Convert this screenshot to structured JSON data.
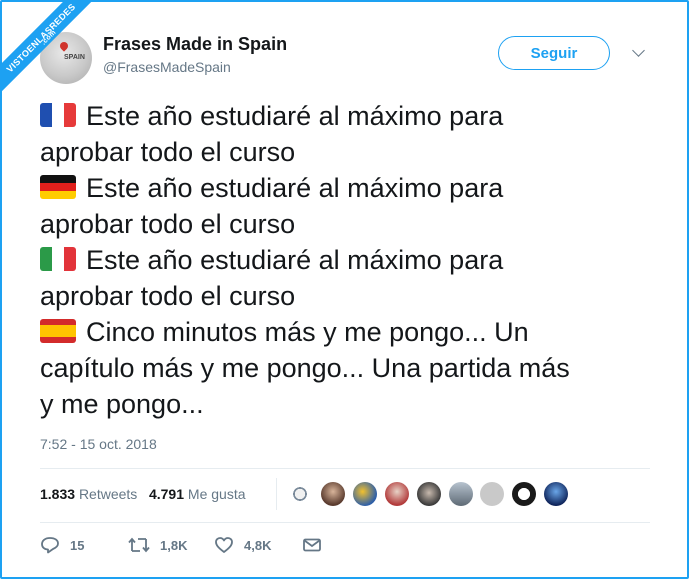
{
  "watermark": {
    "text": "VISTOENLASREDES",
    "suffix": ".com"
  },
  "account": {
    "name": "Frases Made in Spain",
    "handle": "@FrasesMadeSpain",
    "avatar_text": "SPAIN"
  },
  "follow_label": "Seguir",
  "tweet_lines": [
    {
      "flag": "france",
      "text": "Este año estudiaré al máximo para"
    },
    {
      "flag": "",
      "text": "aprobar todo el curso"
    },
    {
      "flag": "germany",
      "text": "Este año estudiaré al máximo para"
    },
    {
      "flag": "",
      "text": "aprobar todo el curso"
    },
    {
      "flag": "italy",
      "text": "Este año estudiaré al máximo para"
    },
    {
      "flag": "",
      "text": "aprobar todo el curso"
    },
    {
      "flag": "spain",
      "text": "Cinco minutos más y me pongo... Un"
    },
    {
      "flag": "",
      "text": "capítulo más y me pongo... Una partida más"
    },
    {
      "flag": "",
      "text": "y me pongo..."
    }
  ],
  "timestamp": "7:52 - 15 oct. 2018",
  "stats": {
    "retweets_count": "1.833",
    "retweets_label": "Retweets",
    "likes_count": "4.791",
    "likes_label": "Me gusta"
  },
  "actions": {
    "replies": "15",
    "retweets": "1,8K",
    "likes": "4,8K"
  },
  "colors": {
    "accent": "#1da1f2",
    "muted": "#657786",
    "text": "#14171a",
    "divider": "#e6ecf0"
  }
}
